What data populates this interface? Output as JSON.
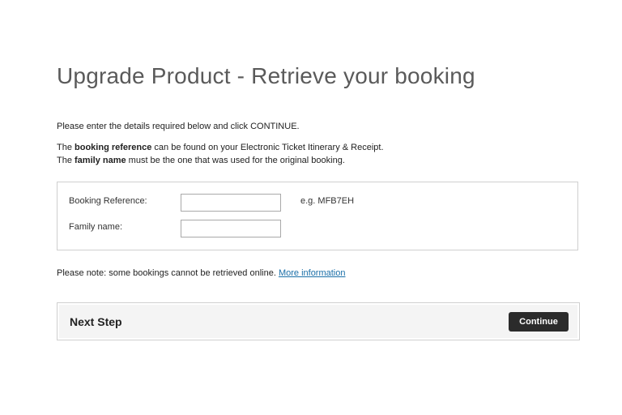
{
  "page": {
    "title": "Upgrade Product - Retrieve your booking"
  },
  "intro": {
    "line1": "Please enter the details required below and click CONTINUE.",
    "line2_prefix": "The ",
    "line2_bold": "booking reference",
    "line2_suffix": " can be found on your Electronic Ticket Itinerary & Receipt.",
    "line3_prefix": "The ",
    "line3_bold": "family name",
    "line3_suffix": " must be the one that was used for the original booking."
  },
  "form": {
    "booking_reference_label": "Booking Reference:",
    "booking_reference_value": "",
    "booking_reference_hint": "e.g. MFB7EH",
    "family_name_label": "Family name:",
    "family_name_value": ""
  },
  "note": {
    "text": "Please note: some bookings cannot be retrieved online. ",
    "link": "More information"
  },
  "next_step": {
    "title": "Next Step",
    "continue_label": "Continue"
  }
}
